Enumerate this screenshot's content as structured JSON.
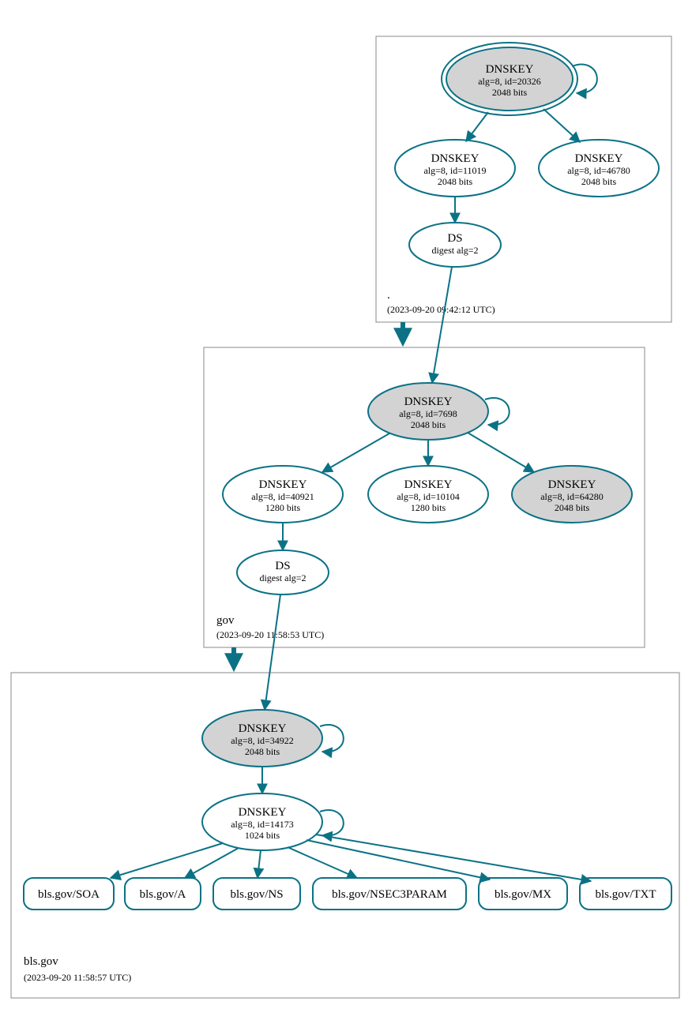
{
  "zones": {
    "root": {
      "title": ".",
      "date": "(2023-09-20 09:42:12 UTC)"
    },
    "gov": {
      "title": "gov",
      "date": "(2023-09-20 11:58:53 UTC)"
    },
    "bls": {
      "title": "bls.gov",
      "date": "(2023-09-20 11:58:57 UTC)"
    }
  },
  "nodes": {
    "root_ksk": {
      "line1": "DNSKEY",
      "line2": "alg=8, id=20326",
      "line3": "2048 bits"
    },
    "root_zsk1": {
      "line1": "DNSKEY",
      "line2": "alg=8, id=11019",
      "line3": "2048 bits"
    },
    "root_zsk2": {
      "line1": "DNSKEY",
      "line2": "alg=8, id=46780",
      "line3": "2048 bits"
    },
    "root_ds": {
      "line1": "DS",
      "line2": "digest alg=2"
    },
    "gov_ksk": {
      "line1": "DNSKEY",
      "line2": "alg=8, id=7698",
      "line3": "2048 bits"
    },
    "gov_zsk1": {
      "line1": "DNSKEY",
      "line2": "alg=8, id=40921",
      "line3": "1280 bits"
    },
    "gov_zsk2": {
      "line1": "DNSKEY",
      "line2": "alg=8, id=10104",
      "line3": "1280 bits"
    },
    "gov_zsk3": {
      "line1": "DNSKEY",
      "line2": "alg=8, id=64280",
      "line3": "2048 bits"
    },
    "gov_ds": {
      "line1": "DS",
      "line2": "digest alg=2"
    },
    "bls_ksk": {
      "line1": "DNSKEY",
      "line2": "alg=8, id=34922",
      "line3": "2048 bits"
    },
    "bls_zsk": {
      "line1": "DNSKEY",
      "line2": "alg=8, id=14173",
      "line3": "1024 bits"
    },
    "rr_soa": {
      "label": "bls.gov/SOA"
    },
    "rr_a": {
      "label": "bls.gov/A"
    },
    "rr_ns": {
      "label": "bls.gov/NS"
    },
    "rr_nsec3": {
      "label": "bls.gov/NSEC3PARAM"
    },
    "rr_mx": {
      "label": "bls.gov/MX"
    },
    "rr_txt": {
      "label": "bls.gov/TXT"
    }
  }
}
